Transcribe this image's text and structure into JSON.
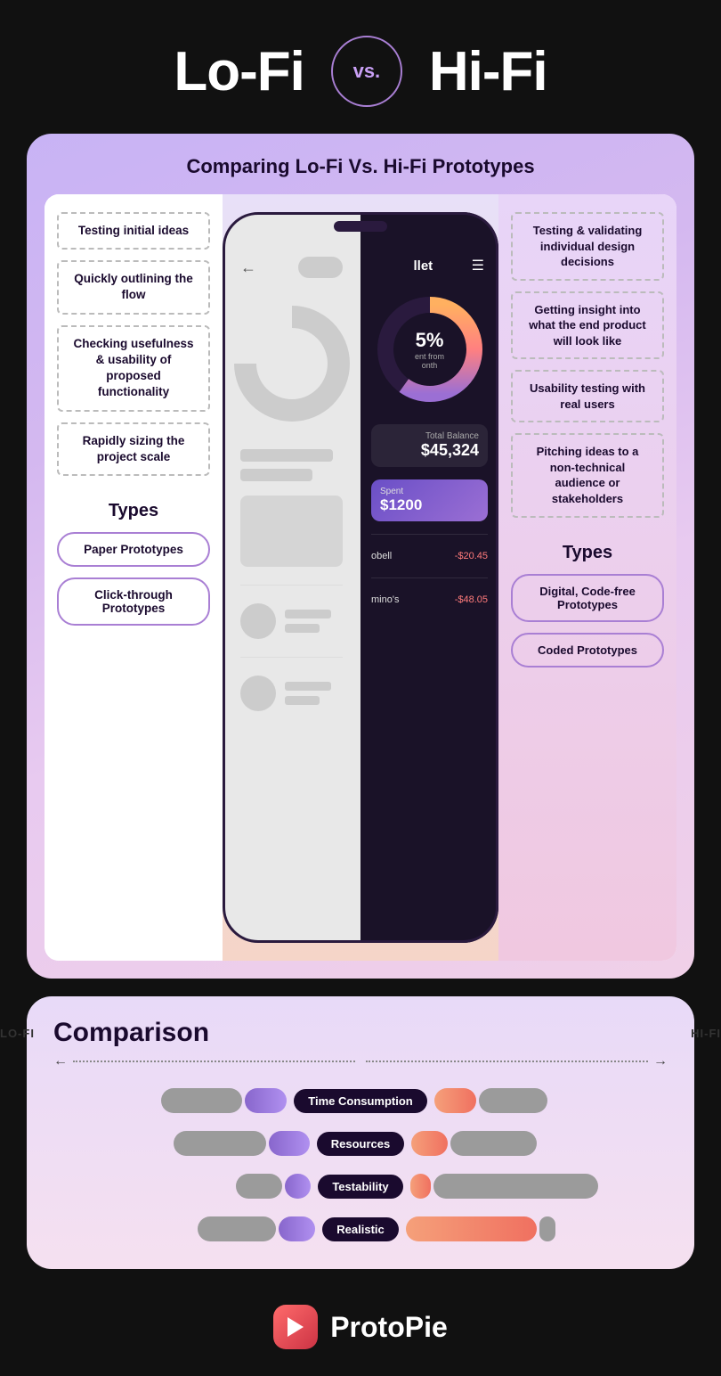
{
  "header": {
    "lofi": "Lo-Fi",
    "vs": "vs.",
    "hifi": "Hi-Fi"
  },
  "card": {
    "title": "Comparing Lo-Fi Vs. Hi-Fi Prototypes"
  },
  "left_column": {
    "uses": [
      "Testing initial ideas",
      "Quickly outlining the flow",
      "Checking usefulness & usability of proposed functionality",
      "Rapidly sizing the project scale"
    ],
    "types_label": "Types",
    "types": [
      "Paper Prototypes",
      "Click-through Prototypes"
    ]
  },
  "right_column": {
    "uses": [
      "Testing & validating individual design decisions",
      "Getting insight into what the end product will look like",
      "Usability testing with real users",
      "Pitching ideas to a non-technical audience or stakeholders"
    ],
    "types_label": "Types",
    "types": [
      "Digital, Code-free Prototypes",
      "Coded Prototypes"
    ]
  },
  "phone": {
    "hifi_title": "llet",
    "balance_label": "Total Balance",
    "balance_amount": "$45,324",
    "spent_label": "Spent",
    "spent_amount": "$1200",
    "pct": "5%",
    "pct_sub": "ent from\nonth",
    "txns": [
      {
        "name": "obell",
        "amount": "-$20.45"
      },
      {
        "name": "mino's",
        "amount": "-$48.05"
      }
    ]
  },
  "comparison": {
    "title": "Comparison",
    "lofi_label": "LO-FI",
    "hifi_label": "HI-FI",
    "bars": [
      {
        "label": "Time Consumption",
        "left_gray": 38,
        "left_purple": 20,
        "right_orange": 20,
        "right_gray": 32
      },
      {
        "label": "Resources",
        "left_gray": 36,
        "left_purple": 16,
        "right_orange": 14,
        "right_gray": 34
      },
      {
        "label": "Testability",
        "left_gray": 18,
        "left_purple": 10,
        "right_orange": 8,
        "right_gray": 64
      },
      {
        "label": "Realistic",
        "left_gray": 30,
        "left_purple": 14,
        "right_orange": 50,
        "right_gray": 6
      }
    ]
  },
  "footer": {
    "brand": "ProtoPie"
  }
}
